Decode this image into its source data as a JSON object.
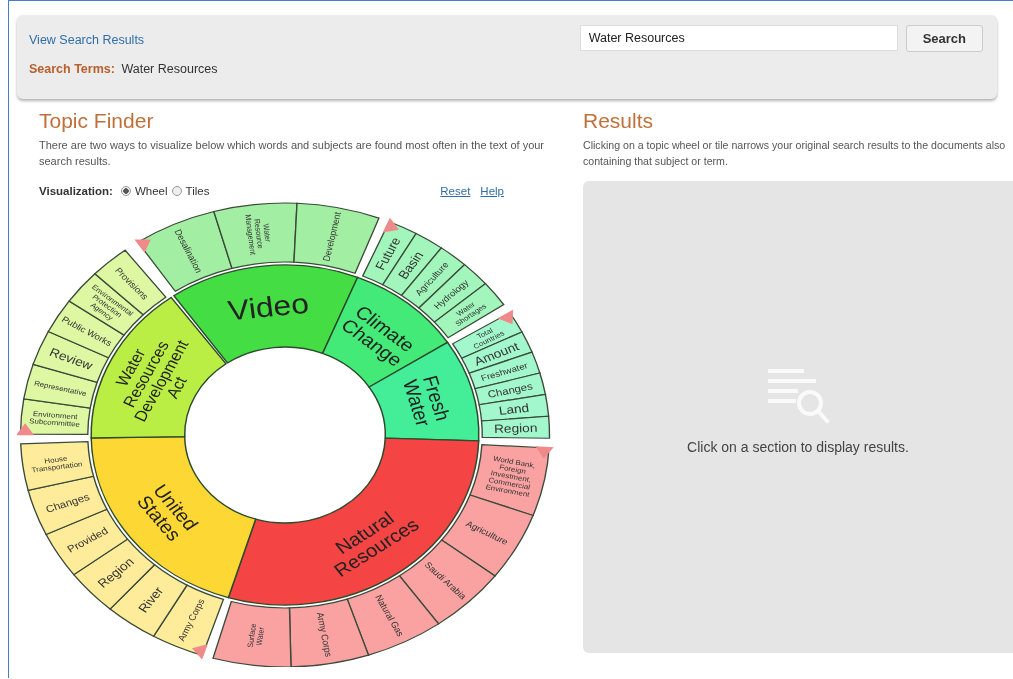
{
  "header": {
    "link": "View Search Results",
    "search_terms_label": "Search Terms:",
    "search_terms": "Water Resources",
    "search_value": "Water Resources",
    "search_button": "Search"
  },
  "topic_finder": {
    "title": "Topic Finder",
    "description": "There are two ways to visualize below which words and subjects are found most often in the text of your search results.",
    "visualization_label": "Visualization:",
    "options": [
      {
        "label": "Wheel",
        "selected": true
      },
      {
        "label": "Tiles",
        "selected": false
      }
    ],
    "links": [
      "Reset",
      "Help"
    ],
    "wheel": [
      {
        "label": "Video",
        "color": "#44dd44",
        "children": [
          "Desalination",
          "Water Resource Management",
          "Development"
        ]
      },
      {
        "label": "Climate Change",
        "color": "#44ea77",
        "children": [
          "Future",
          "Basin",
          "Agriculture",
          "Hydrology",
          "Water Shortages"
        ]
      },
      {
        "label": "Fresh Water",
        "color": "#44ee99",
        "children": [
          "Total Countries",
          "Amount",
          "Freshwater",
          "Changes",
          "Land",
          "Region"
        ]
      },
      {
        "label": "Natural Resources",
        "color": "#f44444",
        "children": [
          "World Bank, Foreign Investment, Commercial Environment",
          "Agriculture",
          "Saudi Arabia",
          "Natural Gas",
          "Army Corps",
          "Surface Water"
        ]
      },
      {
        "label": "United States",
        "color": "#fdd835",
        "children": [
          "Army Corps",
          "River",
          "Region",
          "Provided",
          "Changes",
          "House Transportation"
        ]
      },
      {
        "label": "Water Resources Development Act",
        "color": "#bbee44",
        "children": [
          "Environment Subcommittee",
          "Representative",
          "Review",
          "Public Works",
          "Environmental Protection Agency",
          "Provisions"
        ]
      }
    ]
  },
  "results": {
    "title": "Results",
    "description": "Clicking on a topic wheel or tile narrows your original search results to the documents also containing that subject or term.",
    "empty_message": "Click on a section to display results."
  }
}
